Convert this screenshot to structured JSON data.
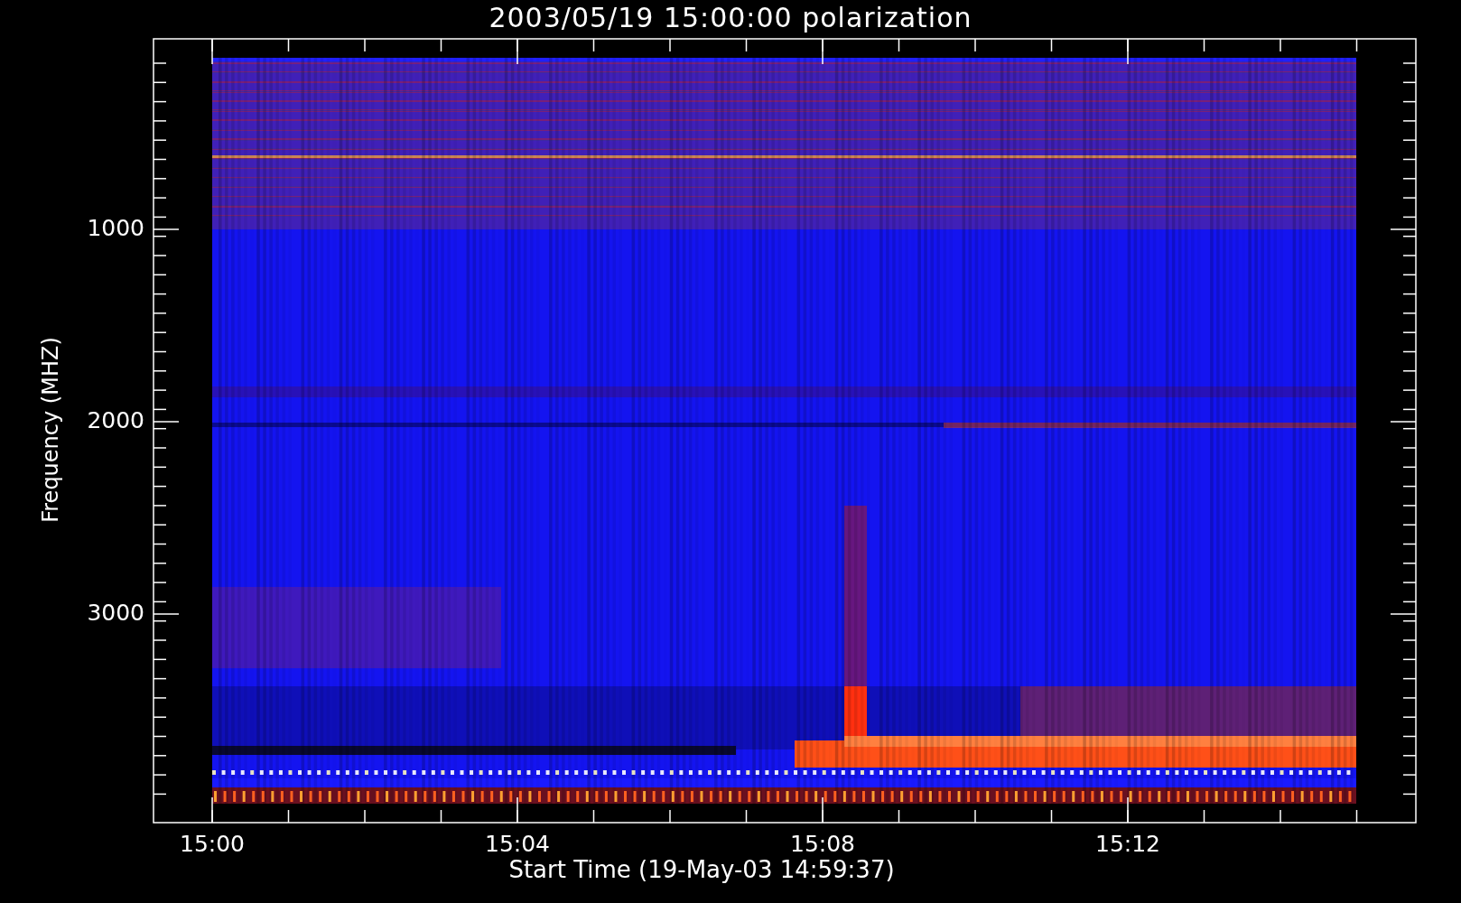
{
  "title": "2003/05/19 15:00:00 polarization",
  "y_axis": {
    "label": "Frequency (MHZ)",
    "ticks": [
      "1000",
      "2000",
      "3000"
    ]
  },
  "x_axis": {
    "label": "Start Time (19-May-03 14:59:37)",
    "ticks": [
      "15:00",
      "15:04",
      "15:08",
      "15:12"
    ]
  }
}
